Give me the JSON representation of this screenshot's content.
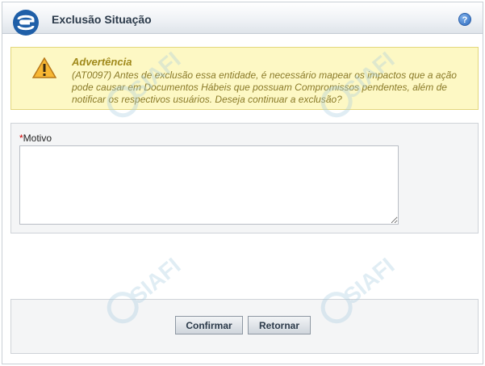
{
  "header": {
    "title": "Exclusão Situação",
    "help_label": "?"
  },
  "warning": {
    "title": "Advertência",
    "message": "(AT0097) Antes de exclusão essa entidade, é necessário mapear os impactos que a ação pode causar em Documentos Hábeis que possuam Compromissos pendentes, além de notificar os respectivos usuários. Deseja continuar a exclusão?"
  },
  "form": {
    "required_marker": "*",
    "motivo_label": "Motivo",
    "motivo_value": ""
  },
  "actions": {
    "confirm_label": "Confirmar",
    "return_label": "Retornar"
  },
  "watermark": {
    "text": "SIAFI"
  },
  "colors": {
    "warning_bg": "#fdf8c4",
    "warning_title": "#a0891a",
    "required": "#cc0000"
  }
}
